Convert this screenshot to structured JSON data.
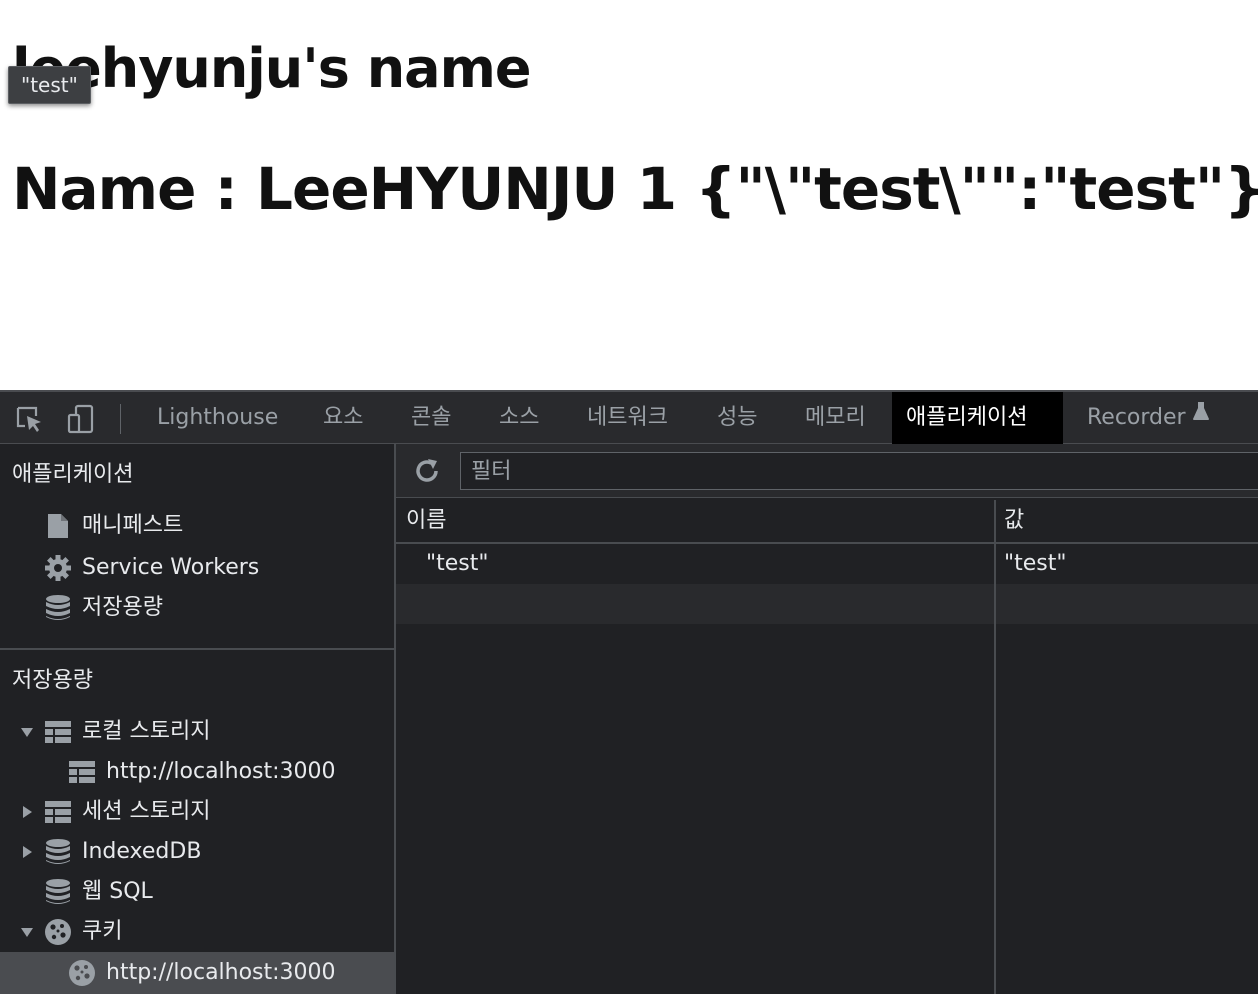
{
  "webpage": {
    "heading": "leehyunju's name",
    "data_line": "Name : LeeHYUNJU 1 {\"\\\"test\\\"\":\"test\"}",
    "tooltip": "\"test\""
  },
  "devtools": {
    "tabs": [
      {
        "label": "Lighthouse",
        "active": false
      },
      {
        "label": "요소",
        "active": false
      },
      {
        "label": "콘솔",
        "active": false
      },
      {
        "label": "소스",
        "active": false
      },
      {
        "label": "네트워크",
        "active": false
      },
      {
        "label": "성능",
        "active": false
      },
      {
        "label": "메모리",
        "active": false
      },
      {
        "label": "애플리케이션",
        "active": true
      },
      {
        "label": "Recorder",
        "active": false
      }
    ],
    "sidebar": {
      "app_header": "애플리케이션",
      "app_items": [
        {
          "label": "매니페스트",
          "icon": "file-icon"
        },
        {
          "label": "Service Workers",
          "icon": "gear-icon"
        },
        {
          "label": "저장용량",
          "icon": "database-icon"
        }
      ],
      "storage_header": "저장용량",
      "storage_items": [
        {
          "label": "로컬 스토리지",
          "icon": "table-icon",
          "expanded": true
        },
        {
          "label": "http://localhost:3000",
          "icon": "table-icon"
        },
        {
          "label": "세션 스토리지",
          "icon": "table-icon",
          "expanded": false
        },
        {
          "label": "IndexedDB",
          "icon": "database-icon",
          "expanded": false
        },
        {
          "label": "웹 SQL",
          "icon": "database-icon"
        },
        {
          "label": "쿠키",
          "icon": "cookie-icon",
          "expanded": true
        },
        {
          "label": "http://localhost:3000",
          "icon": "cookie-icon",
          "selected": true
        }
      ]
    },
    "main": {
      "filter_placeholder": "필터",
      "columns": [
        "이름",
        "값"
      ],
      "rows": [
        {
          "name": "\"test\"",
          "value": "\"test\""
        }
      ]
    }
  }
}
